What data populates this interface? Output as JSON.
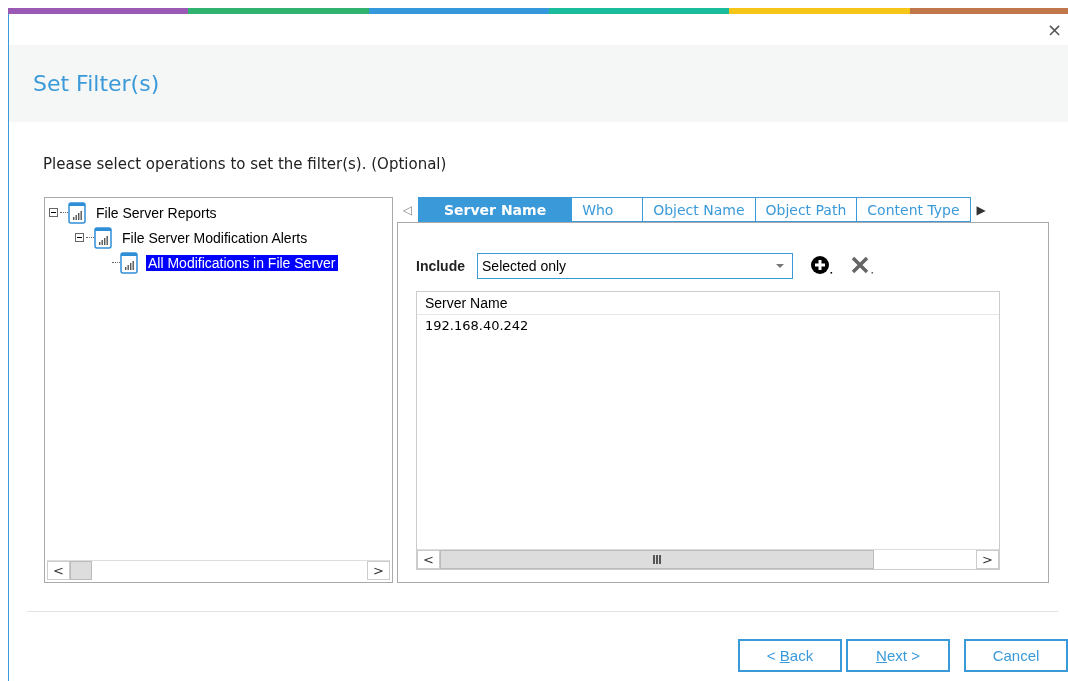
{
  "window": {
    "close": "×",
    "title": "Set Filter(s)"
  },
  "instruction": "Please select operations to set the filter(s). (Optional)",
  "tree": [
    {
      "label": "File Server Reports",
      "expanded": true,
      "selected": false,
      "children": [
        {
          "label": "File Server Modification Alerts",
          "expanded": true,
          "selected": false,
          "children": [
            {
              "label": "All Modifications in File Server",
              "selected": true
            }
          ]
        }
      ]
    }
  ],
  "tree_scroll": {
    "left": "<",
    "right": ">"
  },
  "tab_scroll": {
    "left": "◁",
    "right": "▶"
  },
  "tabs": [
    {
      "label": "Server Name",
      "selected": true
    },
    {
      "label": "Who",
      "selected": false
    },
    {
      "label": "Object Name",
      "selected": false
    },
    {
      "label": "Object Path",
      "selected": false
    },
    {
      "label": "Content Type",
      "selected": false
    }
  ],
  "include": {
    "label": "Include",
    "value": "Selected only"
  },
  "list": {
    "columns": [
      "Server Name"
    ],
    "rows": [
      [
        "192.168.40.242"
      ]
    ],
    "scroll": {
      "left": "<",
      "right": ">"
    }
  },
  "buttons": [
    {
      "before": "< ",
      "key": "B",
      "after": "ack"
    },
    {
      "key": "N",
      "after": "ext >"
    },
    {
      "before": "Cancel"
    }
  ]
}
